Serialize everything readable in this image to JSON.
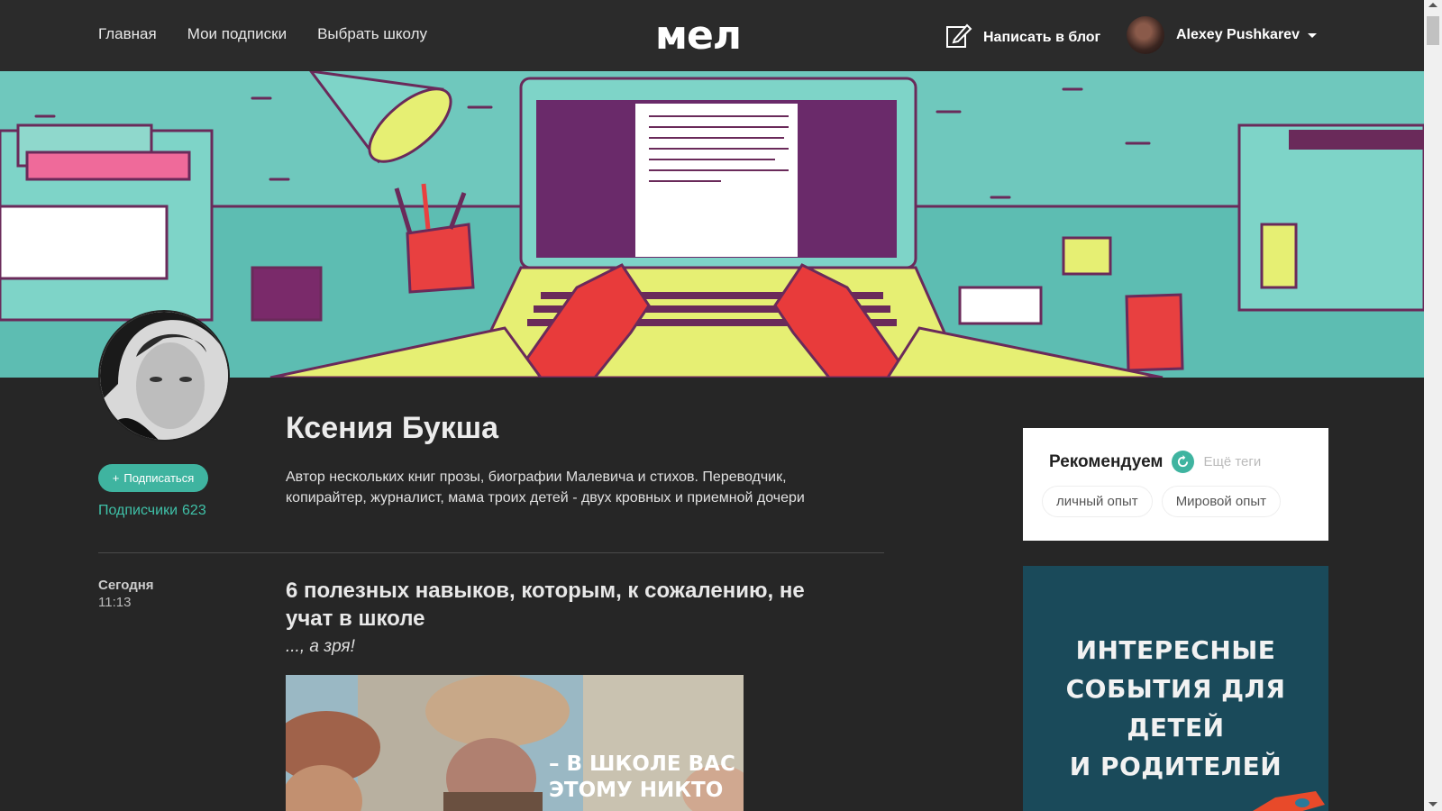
{
  "header": {
    "nav": [
      "Главная",
      "Мои подписки",
      "Выбрать школу"
    ],
    "logo": "мел",
    "write_blog": "Написать в блог",
    "user_name": "Alexey Pushkarev"
  },
  "profile": {
    "name": "Ксения Букша",
    "bio": "Автор нескольких книг прозы, биографии Малевича и стихов. Переводчик, копирайтер, журналист, мама троих детей - двух кровных и приемной дочери",
    "subscribe_label": "Подписаться",
    "followers_label": "Подписчики",
    "followers_count": "623"
  },
  "post": {
    "day": "Сегодня",
    "time": "11:13",
    "title": "6 полезных навыков, которым, к сожалению, не учат в школе",
    "subtitle": "..., а зря!",
    "image_caption_lines": [
      "– В ШКОЛЕ ВАС",
      "ЭТОМУ НИКТО"
    ]
  },
  "sidebar": {
    "recommend_title": "Рекомендуем",
    "more_tags": "Ещё теги",
    "tags": [
      "личный опыт",
      "Мировой опыт"
    ],
    "ad_lines": [
      "ИНТЕРЕСНЫЕ",
      "СОБЫТИЯ ДЛЯ ДЕТЕЙ",
      "И РОДИТЕЛЕЙ"
    ]
  },
  "colors": {
    "accent": "#3fb4a0",
    "background": "#262626",
    "header": "#2b2b2b",
    "ad_background": "#1a4a5a"
  }
}
